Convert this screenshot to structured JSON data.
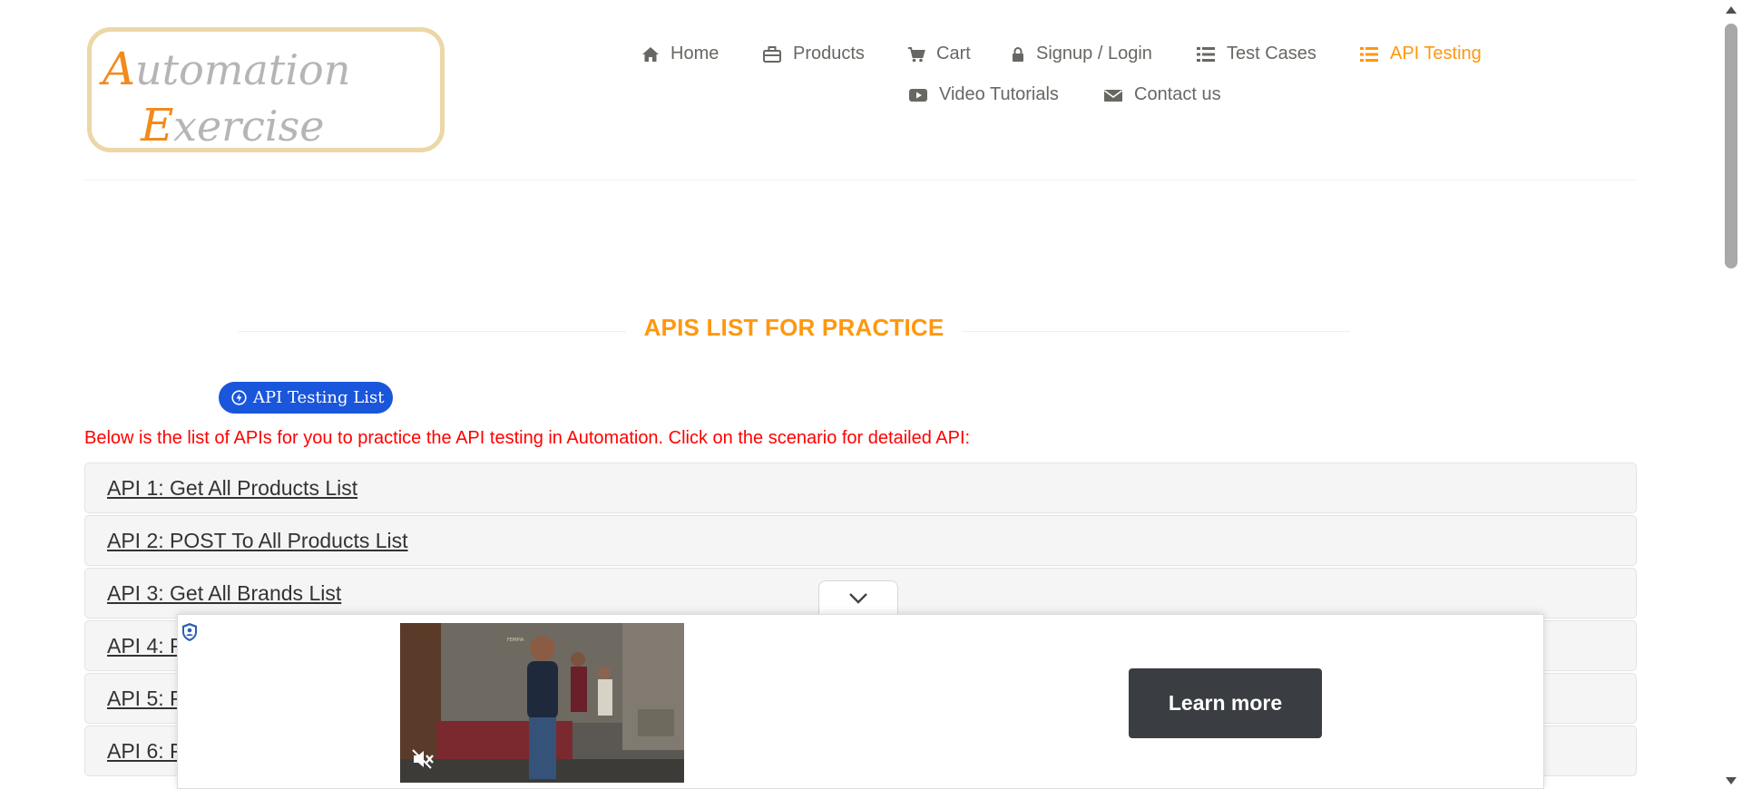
{
  "logo": {
    "line1": "Automation",
    "line2": "Exercise"
  },
  "nav": {
    "home": "Home",
    "products": "Products",
    "cart": "Cart",
    "login": "Signup / Login",
    "test_cases": "Test Cases",
    "api_testing": "API Testing",
    "video": "Video Tutorials",
    "contact": "Contact us"
  },
  "page": {
    "title": "APIS LIST FOR PRACTICE",
    "badge": "API Testing List",
    "intro": "Below is the list of APIs for you to practice the API testing in Automation. Click on the scenario for detailed API:"
  },
  "apis": [
    "API 1: Get All Products List",
    "API 2: POST To All Products List",
    "API 3: Get All Brands List",
    "API 4: P",
    "API 5: P",
    "API 6: P"
  ],
  "ad": {
    "cta": "Learn more"
  },
  "colors": {
    "accent": "#fe980f",
    "intro_red": "#ff0000",
    "badge_blue": "#1a56db",
    "cta_bg": "#3a3d42"
  }
}
